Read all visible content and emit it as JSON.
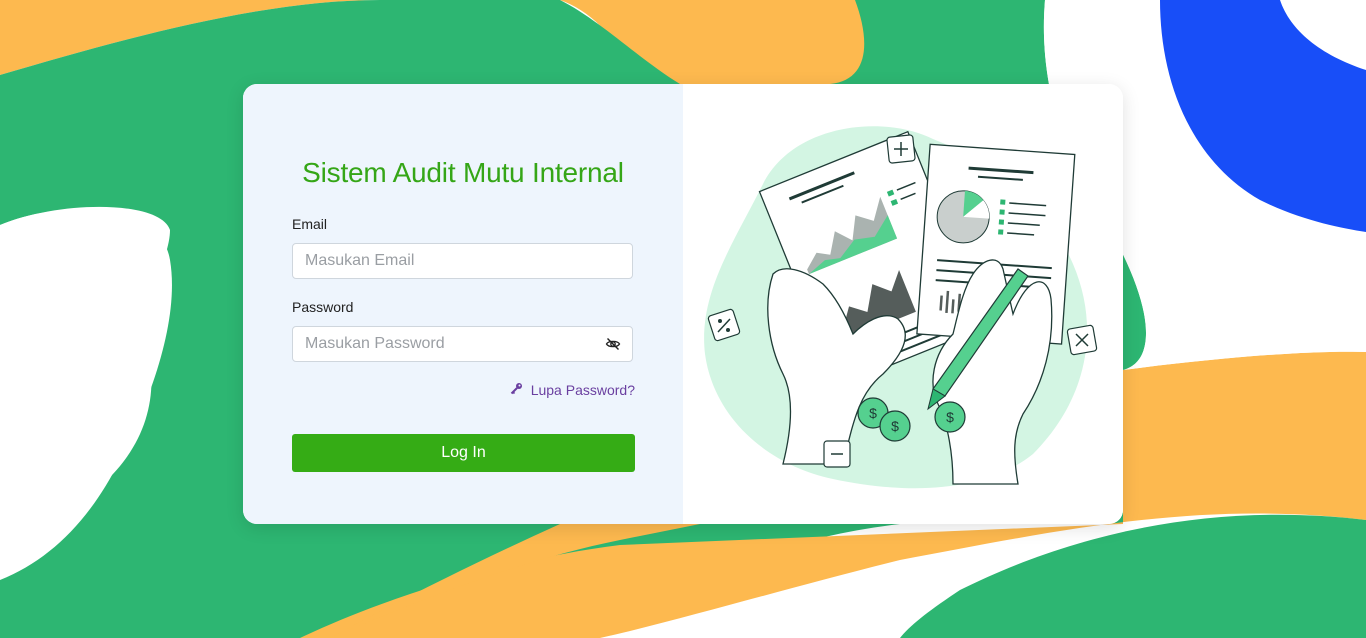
{
  "app": {
    "title": "Sistem Audit Mutu Internal"
  },
  "form": {
    "email_label": "Email",
    "email_placeholder": "Masukan Email",
    "email_value": "",
    "password_label": "Password",
    "password_placeholder": "Masukan Password",
    "password_value": "",
    "forgot_label": "Lupa Password?",
    "login_label": "Log In"
  },
  "icons": {
    "password_toggle": "eye-off-icon",
    "forgot": "key-icon"
  },
  "colors": {
    "brand_green": "#35ac15",
    "title_green": "#35a617",
    "bg_green": "#2db672",
    "bg_orange": "#fdb94f",
    "bg_blue": "#184ef8",
    "link_purple": "#6a3fa0"
  }
}
